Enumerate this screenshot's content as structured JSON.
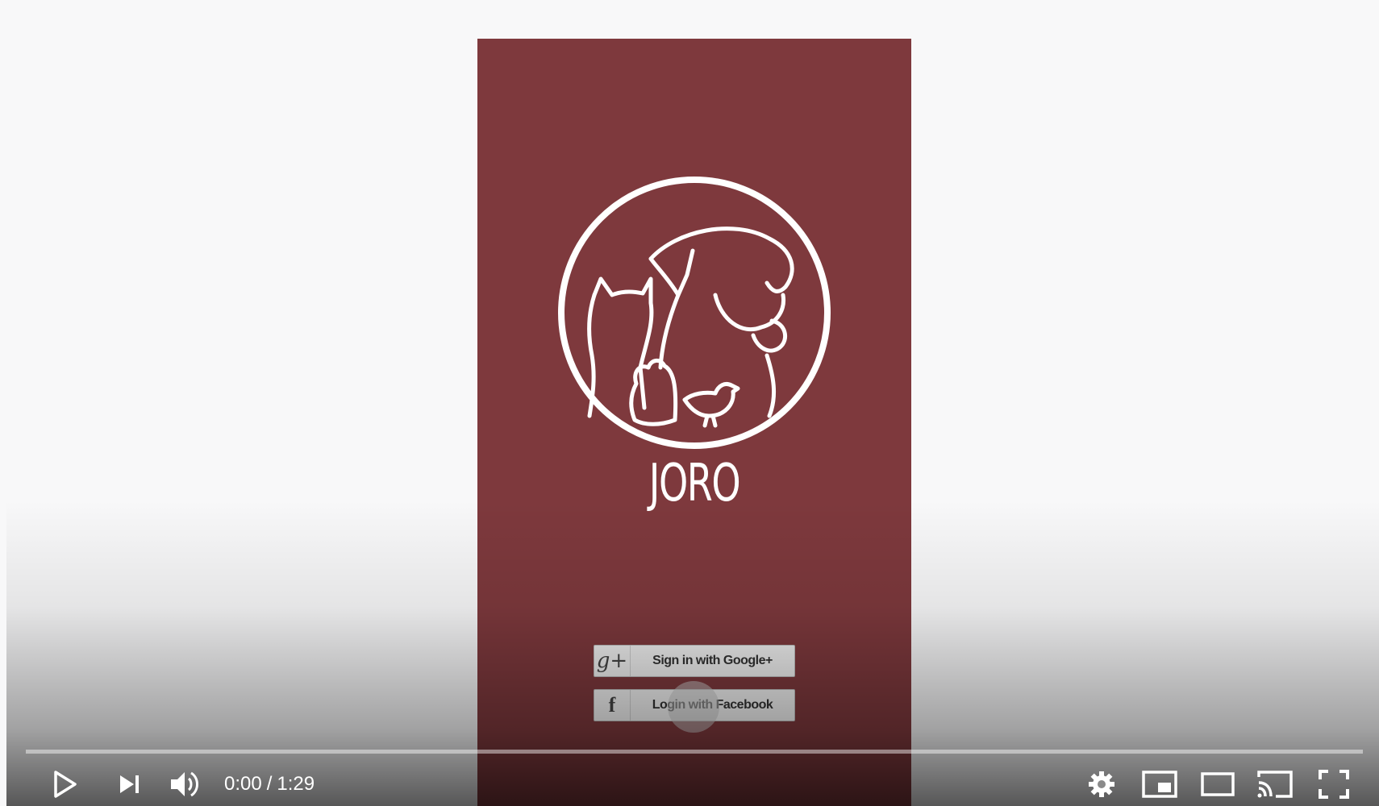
{
  "app": {
    "title": "JORO",
    "brand_color": "#7e393d"
  },
  "login": {
    "google": {
      "icon": "g+",
      "label": "Sign in with Google+"
    },
    "facebook": {
      "icon": "f",
      "label": "Login with Facebook"
    }
  },
  "player": {
    "current_time": "0:00",
    "separator": "/",
    "duration": "1:29",
    "progress_fraction": 0,
    "controls": {
      "play": "play-icon",
      "next": "next-icon",
      "volume": "volume-icon",
      "settings": "gear-icon",
      "miniplayer": "miniplayer-icon",
      "theater": "theater-icon",
      "cast": "cast-icon",
      "fullscreen": "fullscreen-icon"
    }
  }
}
